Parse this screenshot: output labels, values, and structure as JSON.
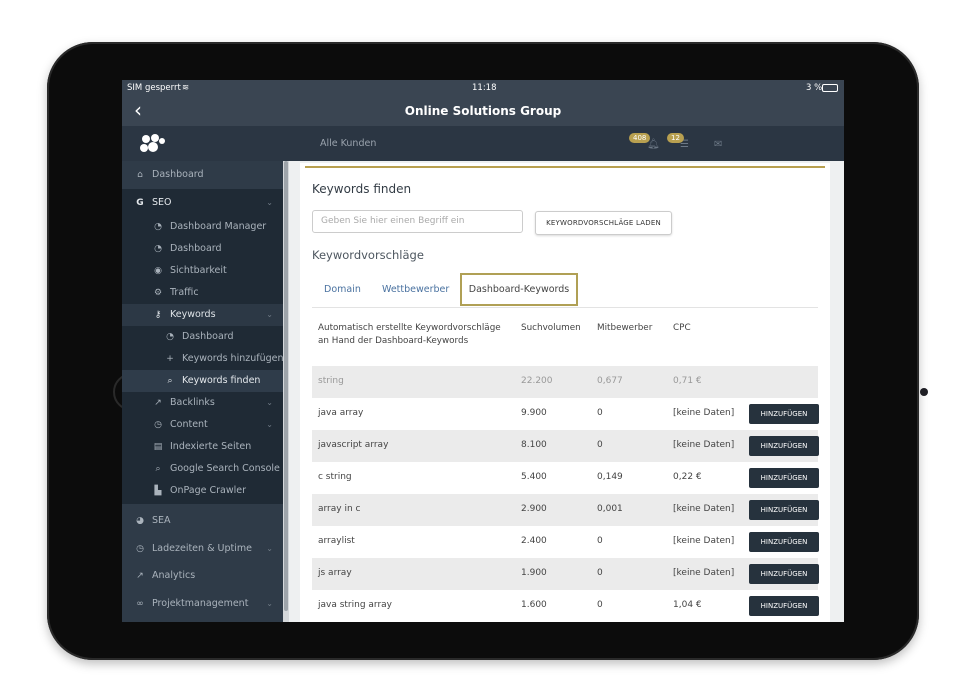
{
  "status": {
    "carrier": "SIM gesperrt",
    "time": "11:18",
    "battery": "3 %"
  },
  "nav": {
    "title": "Online Solutions Group"
  },
  "header": {
    "client_select": "Alle Kunden",
    "notifications_count": "408",
    "tasks_count": "12"
  },
  "sidebar": {
    "dashboard": "Dashboard",
    "seo": "SEO",
    "seo_items": [
      "Dashboard Manager",
      "Dashboard",
      "Sichtbarkeit",
      "Traffic",
      "Keywords"
    ],
    "keyword_items": [
      "Dashboard",
      "Keywords hinzufügen",
      "Keywords finden"
    ],
    "seo_items2": [
      "Backlinks",
      "Content",
      "Indexierte Seiten",
      "Google Search Console",
      "OnPage Crawler"
    ],
    "sea": "SEA",
    "ladezeiten": "Ladezeiten & Uptime",
    "analytics": "Analytics",
    "projekt": "Projektmanagement"
  },
  "main": {
    "title": "Keywords finden",
    "search_placeholder": "Geben Sie hier einen Begriff ein",
    "load_button": "KEYWORDVORSCHLÄGE LADEN",
    "subtitle": "Keywordvorschläge",
    "tabs": [
      "Domain",
      "Wettbewerber",
      "Dashboard-Keywords"
    ],
    "active_tab": "Dashboard-Keywords",
    "columns": [
      "Automatisch erstellte Keywordvorschläge an Hand der Dashboard-Keywords",
      "Suchvolumen",
      "Mitbewerber",
      "CPC"
    ],
    "add_label": "HINZUFÜGEN",
    "rows": [
      {
        "keyword": "string",
        "volume": "22.200",
        "competition": "0,677",
        "cpc": "0,71 €"
      },
      {
        "keyword": "java array",
        "volume": "9.900",
        "competition": "0",
        "cpc": "[keine Daten]"
      },
      {
        "keyword": "javascript array",
        "volume": "8.100",
        "competition": "0",
        "cpc": "[keine Daten]"
      },
      {
        "keyword": "c string",
        "volume": "5.400",
        "competition": "0,149",
        "cpc": "0,22 €"
      },
      {
        "keyword": "array in c",
        "volume": "2.900",
        "competition": "0,001",
        "cpc": "[keine Daten]"
      },
      {
        "keyword": "arraylist",
        "volume": "2.400",
        "competition": "0",
        "cpc": "[keine Daten]"
      },
      {
        "keyword": "js array",
        "volume": "1.900",
        "competition": "0",
        "cpc": "[keine Daten]"
      },
      {
        "keyword": "java string array",
        "volume": "1.600",
        "competition": "0",
        "cpc": "1,04 €"
      }
    ]
  },
  "colors": {
    "accent_gold": "#b8a050",
    "dark": "#26323d",
    "link": "#4a72a0"
  }
}
